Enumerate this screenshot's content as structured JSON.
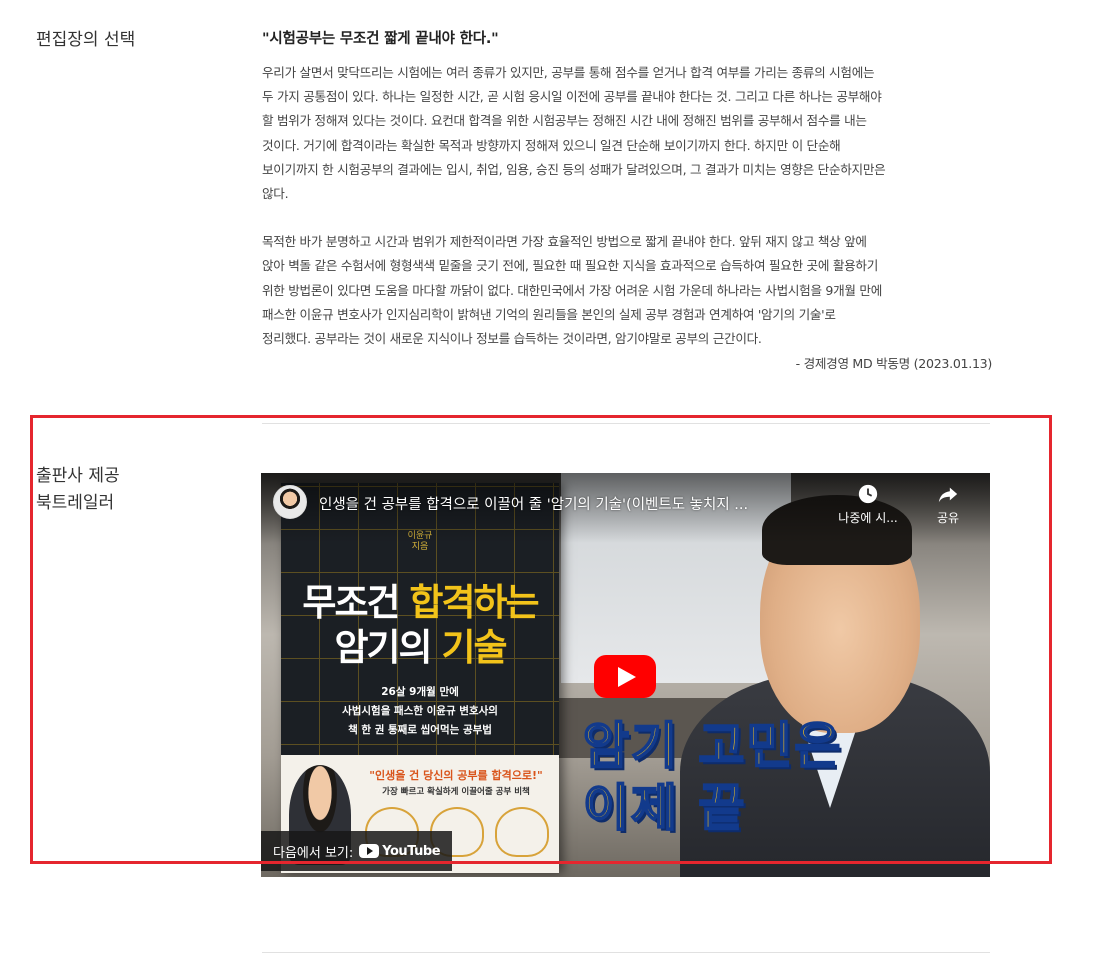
{
  "editor": {
    "label": "편집장의 선택",
    "title": "\"시험공부는 무조건 짧게 끝내야 한다.\"",
    "paragraph1": "우리가 살면서 맞닥뜨리는 시험에는 여러 종류가 있지만, 공부를 통해 점수를 얻거나 합격 여부를 가리는 종류의 시험에는\n두 가지 공통점이 있다. 하나는 일정한 시간, 곧 시험 응시일 이전에 공부를 끝내야 한다는 것. 그리고 다른 하나는 공부해야\n할 범위가 정해져 있다는 것이다. 요컨대 합격을 위한 시험공부는 정해진 시간 내에 정해진 범위를 공부해서 점수를 내는\n것이다. 거기에 합격이라는 확실한 목적과 방향까지 정해져 있으니 일견 단순해 보이기까지 한다. 하지만 이 단순해\n보이기까지 한 시험공부의 결과에는 입시, 취업, 임용, 승진 등의 성패가 달려있으며, 그 결과가 미치는 영향은 단순하지만은\n않다.",
    "paragraph2": "목적한 바가 분명하고 시간과 범위가 제한적이라면 가장 효율적인 방법으로 짧게 끝내야 한다. 앞뒤 재지 않고 책상 앞에\n앉아 벽돌 같은 수험서에 형형색색 밑줄을 긋기 전에, 필요한 때 필요한 지식을 효과적으로 습득하여 필요한 곳에 활용하기\n위한 방법론이 있다면 도움을 마다할 까닭이 없다. 대한민국에서 가장 어려운 시험 가운데 하나라는 사법시험을 9개월 만에\n패스한 이윤규 변호사가 인지심리학이 밝혀낸 기억의 원리들을 본인의 실제 공부 경험과 연계하여 '암기의 기술'로\n정리했다. 공부라는 것이 새로운 지식이나 정보를 습득하는 것이라면, 암기야말로 공부의 근간이다.",
    "signature": "- 경제경영 MD 박동명 (2023.01.13)"
  },
  "trailer": {
    "label": "출판사 제공\n북트레일러",
    "video_title": "인생을 건 공부를 합격으로 이끌어 줄 '암기의 기술'(이벤트도 놓치지 ...",
    "watch_later": "나중에 시...",
    "share": "공유",
    "watch_on": "다음에서 보기:",
    "youtube": "YouTube",
    "overlay": "암기 고민은\n이제 끝",
    "book": {
      "author": "이윤규\n지음",
      "title_line1_a": "무조건 ",
      "title_line1_b": "합격하는",
      "title_line2_a": "암기의 ",
      "title_line2_b": "기술",
      "subtitle": "26살 9개월 만에\n사법시험을 패스한 이윤규 변호사의\n책 한 권 통째로 씹어먹는 공부법",
      "quote": "\"인생을 건 당신의 공부를 합격으로!\"",
      "desc": "가장 빠르고 확실하게 이끌어줄 공부 비책"
    }
  },
  "colors": {
    "highlight_border": "#e5262e",
    "play_red": "#ff0000",
    "overlay_yellow": "#f7c21b"
  }
}
